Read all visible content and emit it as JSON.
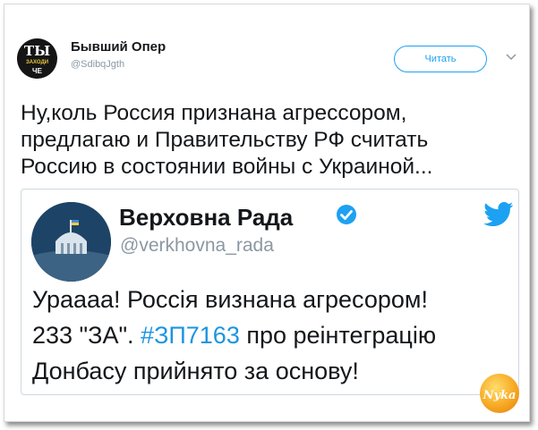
{
  "tweet": {
    "author_name": "Бывший Опер",
    "author_handle": "@SdibqJgth",
    "avatar_text_top": "ТЫ",
    "avatar_text_mid": "ЗАХОДИ",
    "avatar_text_bot": "ЧЕ",
    "follow_label": "Читать",
    "caret_icon": "chevron-down-icon",
    "text_lines": [
      "Ну,коль Россия признана агрессором,",
      "предлагаю и Правительству РФ считать",
      "Россию в состоянии войны с Украиной..."
    ]
  },
  "quoted": {
    "name": "Верховна Рада",
    "handle": "@verkhovna_rada",
    "verified_icon": "verified-badge-icon",
    "bird_icon": "twitter-bird-icon",
    "line1": "Урааaa! Россія визнана агресором!",
    "line2_pre": "233 \"ЗА\". ",
    "hashtag": "#ЗП7163",
    "line2_post": " про реінтеграцію",
    "line3": "Донбасу прийнято за основу!"
  },
  "watermark": {
    "text": "Nyka"
  },
  "colors": {
    "accent": "#1da1f2",
    "hashtag": "#1b95e0",
    "text": "#14171a",
    "secondary": "#8c98a2"
  }
}
